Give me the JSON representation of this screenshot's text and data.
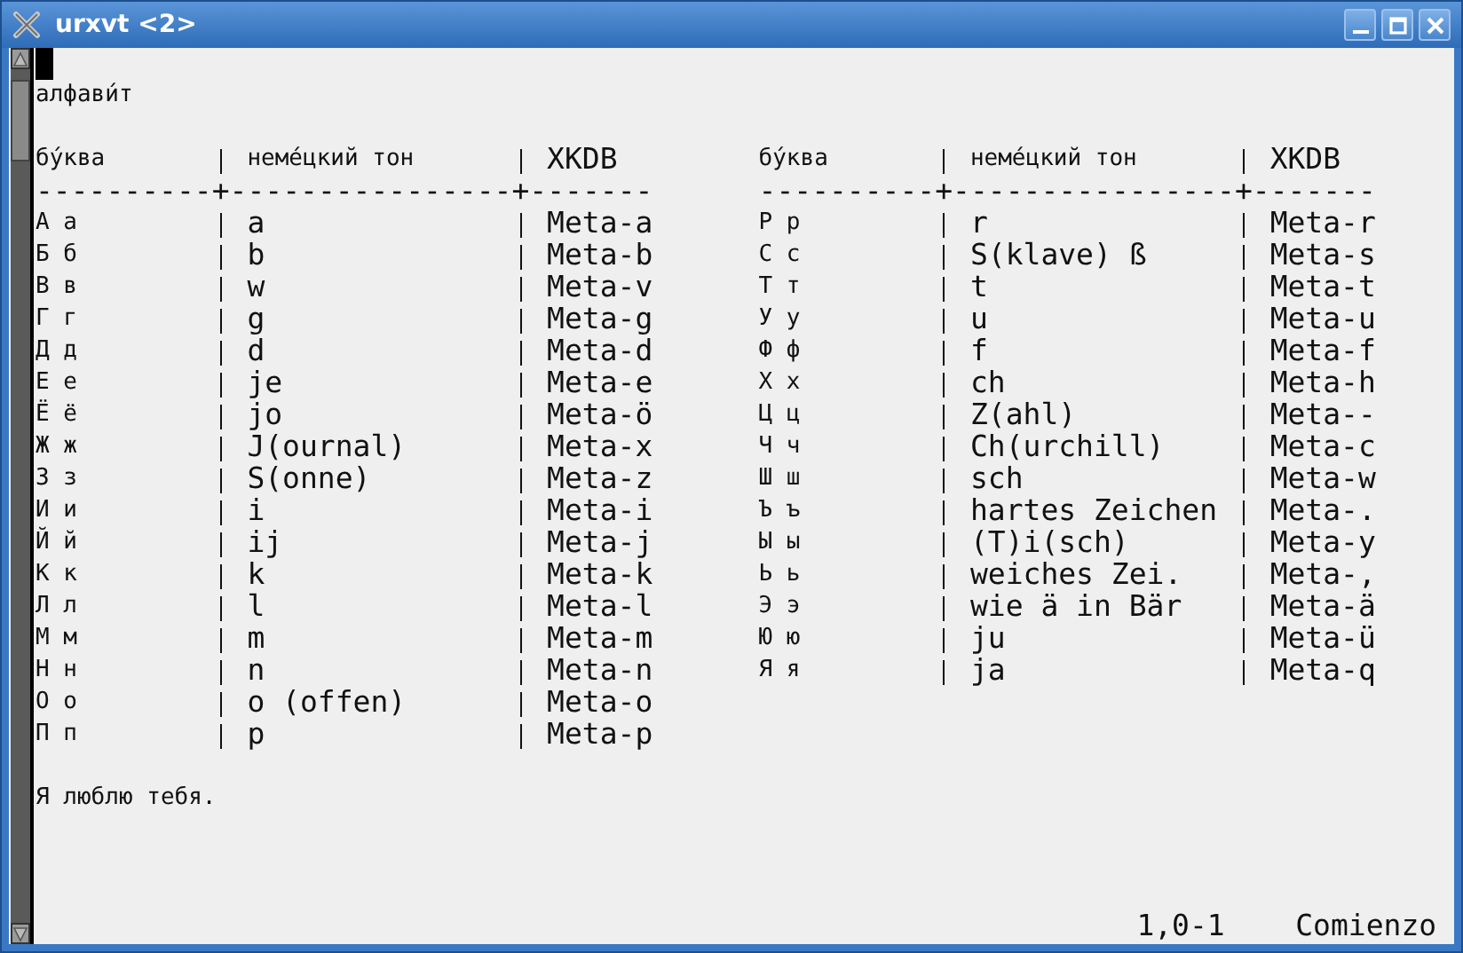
{
  "window": {
    "title": "urxvt <2>"
  },
  "terminal": {
    "cursor": {
      "visible": true
    },
    "heading": "алфави́т",
    "tables": [
      {
        "columns": [
          "бу́ква",
          "неме́цкий тон",
          "XKDB"
        ],
        "separator": "----------+----------------+-------",
        "rows": [
          {
            "letter": "А а",
            "sound": "a",
            "key": "Meta-a"
          },
          {
            "letter": "Б б",
            "sound": "b",
            "key": "Meta-b"
          },
          {
            "letter": "В в",
            "sound": "w",
            "key": "Meta-v"
          },
          {
            "letter": "Г г",
            "sound": "g",
            "key": "Meta-g"
          },
          {
            "letter": "Д д",
            "sound": "d",
            "key": "Meta-d"
          },
          {
            "letter": "Е е",
            "sound": "je",
            "key": "Meta-e"
          },
          {
            "letter": "Ё ё",
            "sound": "jo",
            "key": "Meta-ö"
          },
          {
            "letter": "Ж ж",
            "sound": "J(ournal)",
            "key": "Meta-x"
          },
          {
            "letter": "З з",
            "sound": "S(onne)",
            "key": "Meta-z"
          },
          {
            "letter": "И и",
            "sound": "i",
            "key": "Meta-i"
          },
          {
            "letter": "Й й",
            "sound": "ij",
            "key": "Meta-j"
          },
          {
            "letter": "К к",
            "sound": "k",
            "key": "Meta-k"
          },
          {
            "letter": "Л л",
            "sound": "l",
            "key": "Meta-l"
          },
          {
            "letter": "М м",
            "sound": "m",
            "key": "Meta-m"
          },
          {
            "letter": "Н н",
            "sound": "n",
            "key": "Meta-n"
          },
          {
            "letter": "О о",
            "sound": "o (offen)",
            "key": "Meta-o"
          },
          {
            "letter": "П п",
            "sound": "p",
            "key": "Meta-p"
          }
        ]
      },
      {
        "columns": [
          "бу́ква",
          "неме́цкий тон",
          "XKDB"
        ],
        "separator": "----------+----------------+-------",
        "rows": [
          {
            "letter": "Р р",
            "sound": "r",
            "key": "Meta-r"
          },
          {
            "letter": "С с",
            "sound": "S(klave) ß",
            "key": "Meta-s"
          },
          {
            "letter": "Т т",
            "sound": "t",
            "key": "Meta-t"
          },
          {
            "letter": "У у",
            "sound": "u",
            "key": "Meta-u"
          },
          {
            "letter": "Ф ф",
            "sound": "f",
            "key": "Meta-f"
          },
          {
            "letter": "Х х",
            "sound": "ch",
            "key": "Meta-h"
          },
          {
            "letter": "Ц ц",
            "sound": "Z(ahl)",
            "key": "Meta--"
          },
          {
            "letter": "Ч ч",
            "sound": "Ch(urchill)",
            "key": "Meta-c"
          },
          {
            "letter": "Ш ш",
            "sound": "sch",
            "key": "Meta-w"
          },
          {
            "letter": "Ъ ъ",
            "sound": "hartes Zeichen",
            "key": "Meta-."
          },
          {
            "letter": "Ы ы",
            "sound": "(T)i(sch)",
            "key": "Meta-y"
          },
          {
            "letter": "Ь ь",
            "sound": "weiches Zei.",
            "key": "Meta-,"
          },
          {
            "letter": "Э э",
            "sound": "wie ä in Bär",
            "key": "Meta-ä"
          },
          {
            "letter": "Ю ю",
            "sound": "ju",
            "key": "Meta-ü"
          },
          {
            "letter": "Я я",
            "sound": "ja",
            "key": "Meta-q"
          }
        ]
      }
    ],
    "footer": "Я люблю тебя.",
    "status": {
      "position": "1,0-1",
      "scroll": "Comienzo"
    }
  }
}
